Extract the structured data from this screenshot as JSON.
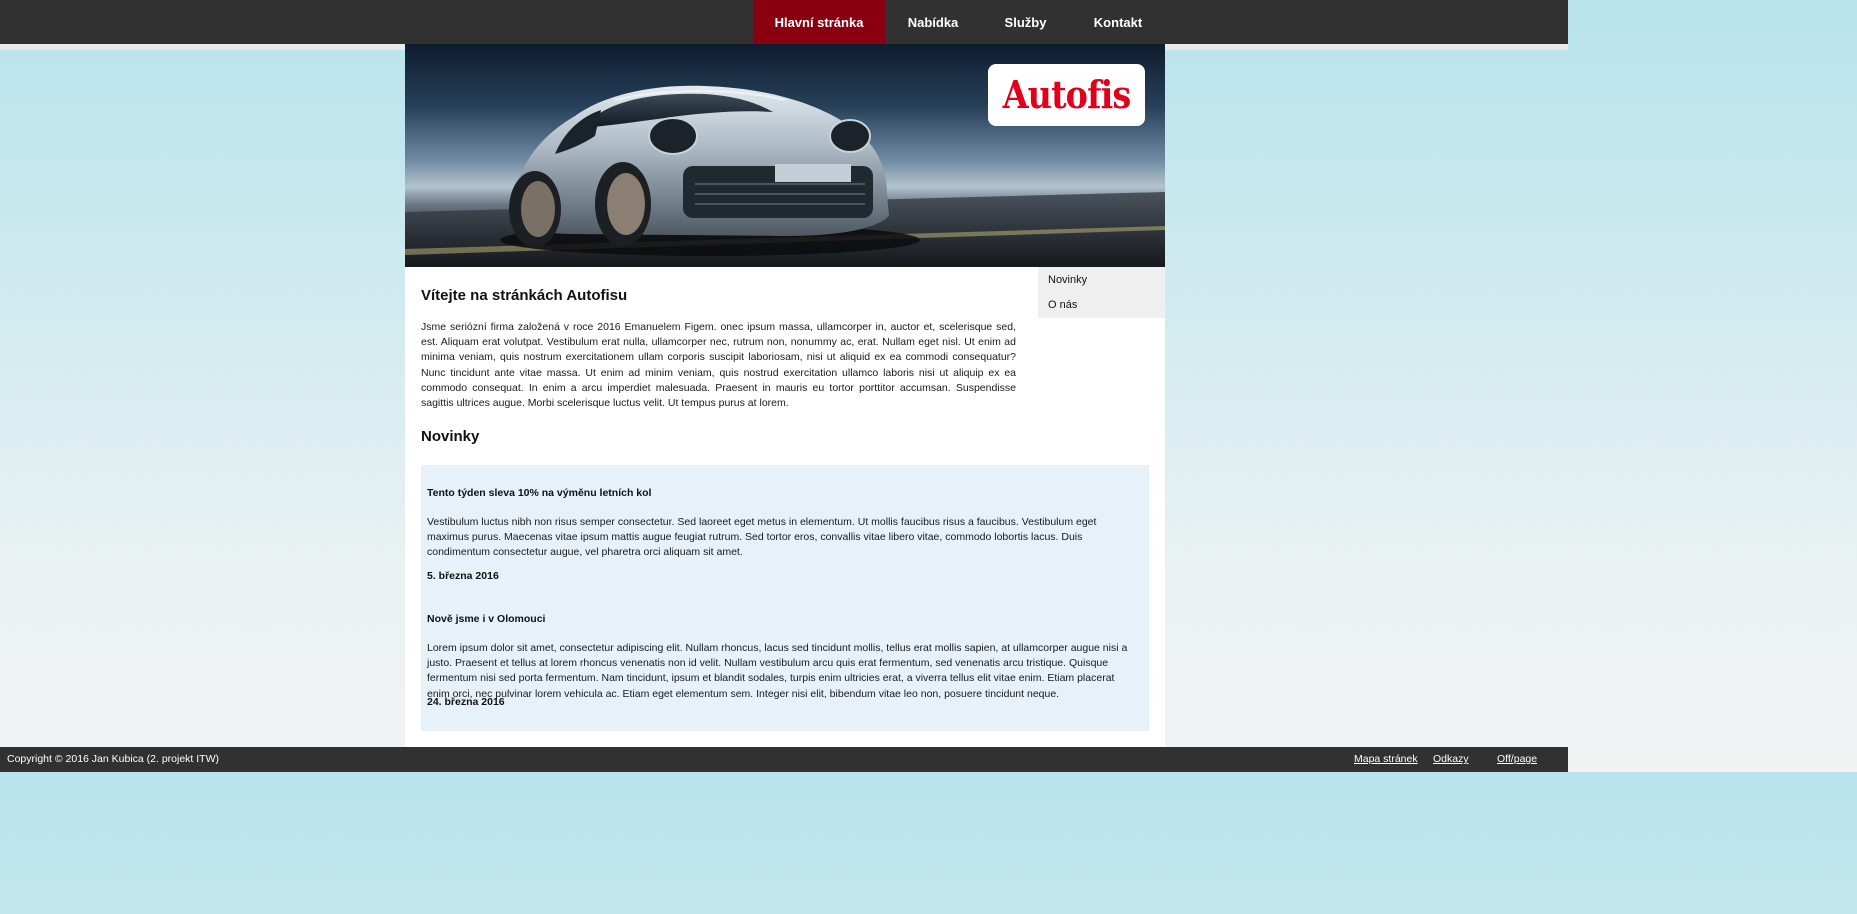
{
  "nav": {
    "items": [
      {
        "label": "Hlavní stránka",
        "active": true
      },
      {
        "label": "Nabídka",
        "active": false
      },
      {
        "label": "Služby",
        "active": false
      },
      {
        "label": "Kontakt",
        "active": false
      }
    ]
  },
  "banner": {
    "logo_text": "Autofis",
    "image": "sports-car-photo"
  },
  "sidebar": {
    "items": [
      {
        "label": "Novinky"
      },
      {
        "label": "O nás"
      }
    ]
  },
  "main": {
    "title": "Vítejte na stránkách Autofisu",
    "intro": "Jsme seriózní firma založená v roce 2016 Emanuelem Figem. onec ipsum massa, ullamcorper in, auctor et, scelerisque sed, est. Aliquam erat volutpat. Vestibulum erat nulla, ullamcorper nec, rutrum non, nonummy ac, erat. Nullam eget nisl. Ut enim ad minima veniam, quis nostrum exercitationem ullam corporis suscipit laboriosam, nisi ut aliquid ex ea commodi consequatur? Nunc tincidunt ante vitae massa. Ut enim ad minim veniam, quis nostrud exercitation ullamco laboris nisi ut aliquip ex ea commodo consequat. In enim a arcu imperdiet malesuada. Praesent in mauris eu tortor porttitor accumsan. Suspendisse sagittis ultrices augue. Morbi scelerisque luctus velit. Ut tempus purus at lorem.",
    "news_heading": "Novinky"
  },
  "news": [
    {
      "title": "Tento týden sleva 10% na výměnu letních kol",
      "body": "Vestibulum luctus nibh non risus semper consectetur. Sed laoreet eget metus in elementum. Ut mollis faucibus risus a faucibus. Vestibulum eget maximus purus. Maecenas vitae ipsum mattis augue feugiat rutrum. Sed tortor eros, convallis vitae libero vitae, commodo lobortis lacus. Duis condimentum consectetur augue, vel pharetra orci aliquam sit amet.",
      "date": "5. března 2016"
    },
    {
      "title": "Nově jsme i v Olomouci",
      "body": "Lorem ipsum dolor sit amet, consectetur adipiscing elit. Nullam rhoncus, lacus sed tincidunt mollis, tellus erat mollis sapien, at ullamcorper augue nisi a justo. Praesent et tellus at lorem rhoncus venenatis non id velit. Nullam vestibulum arcu quis erat fermentum, sed venenatis arcu tristique. Quisque fermentum nisi sed porta fermentum. Nam tincidunt, ipsum et blandit sodales, turpis enim ultricies erat, a viverra tellus elit vitae enim. Etiam placerat enim orci, nec pulvinar lorem vehicula ac. Etiam eget elementum sem. Integer nisi elit, bibendum vitae leo non, posuere tincidunt neque.",
      "date": "24. března 2016"
    }
  ],
  "footer": {
    "copyright": "Copyright © 2016 Jan Kubica (2. projekt ITW)",
    "links": [
      {
        "label": "Mapa stránek"
      },
      {
        "label": "Odkazy"
      },
      {
        "label": "Off/page"
      }
    ]
  },
  "colors": {
    "topbar": "#313131",
    "active_nav": "#8a0010",
    "logo_red": "#e0001b",
    "news_bg": "#e6f1fa",
    "sidebar_bg": "#efefef"
  }
}
